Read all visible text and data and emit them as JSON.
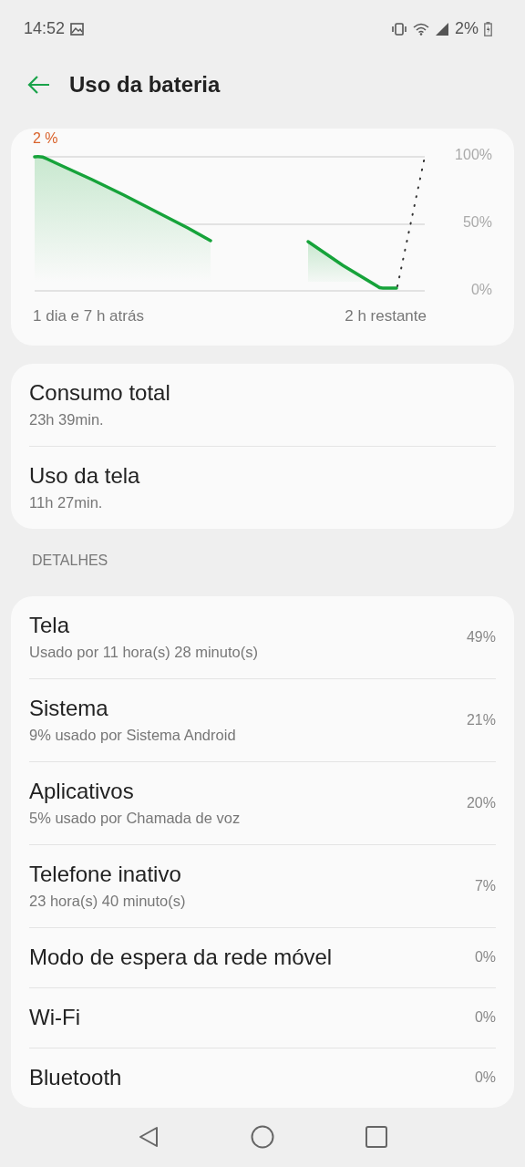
{
  "status_bar": {
    "time": "14:52",
    "battery": "2%"
  },
  "header": {
    "title": "Uso da bateria"
  },
  "chart_card": {
    "level_text": "2 %",
    "y_labels": [
      "100%",
      "50%",
      "0%"
    ],
    "x_start": "1 dia e 7 h atrás",
    "x_end": "2 h restante"
  },
  "summary": [
    {
      "title": "Consumo total",
      "subtitle": "23h 39min."
    },
    {
      "title": "Uso da tela",
      "subtitle": "11h 27min."
    }
  ],
  "details_heading": "DETALHES",
  "details": [
    {
      "title": "Tela",
      "subtitle": "Usado por 11 hora(s) 28 minuto(s)",
      "percent": "49%"
    },
    {
      "title": "Sistema",
      "subtitle": "9% usado por Sistema Android",
      "percent": "21%"
    },
    {
      "title": "Aplicativos",
      "subtitle": "5% usado por Chamada de voz",
      "percent": "20%"
    },
    {
      "title": "Telefone inativo",
      "subtitle": "23 hora(s) 40 minuto(s)",
      "percent": "7%"
    },
    {
      "title": "Modo de espera da rede móvel",
      "percent": "0%"
    },
    {
      "title": "Wi-Fi",
      "percent": "0%"
    },
    {
      "title": "Bluetooth",
      "percent": "0%"
    }
  ]
}
